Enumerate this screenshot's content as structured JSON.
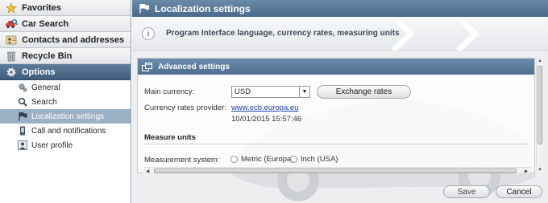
{
  "sidebar": {
    "categories": [
      {
        "label": "Favorites",
        "icon": "star-icon"
      },
      {
        "label": "Car Search",
        "icon": "car-search-icon"
      },
      {
        "label": "Contacts and addresses",
        "icon": "contacts-icon"
      },
      {
        "label": "Recycle Bin",
        "icon": "recycle-bin-icon"
      },
      {
        "label": "Options",
        "icon": "options-gear-icon"
      }
    ],
    "sub_items": [
      {
        "label": "General",
        "icon": "gears-icon"
      },
      {
        "label": "Search",
        "icon": "magnifier-icon"
      },
      {
        "label": "Localization settings",
        "icon": "flag-icon"
      },
      {
        "label": "Call and notifications",
        "icon": "phone-icon"
      },
      {
        "label": "User profile",
        "icon": "user-profile-icon"
      }
    ],
    "active_sub": "Localization settings"
  },
  "header": {
    "title": "Localization settings",
    "info": "Program Interface language, currency rates, measuring units"
  },
  "panel": {
    "title": "Advanced settings",
    "main_currency_label": "Main currency:",
    "main_currency_value": "USD",
    "exchange_button": "Exchange rates",
    "provider_label": "Currency rates provider:",
    "provider_link": "www.ecb.europa.eu",
    "provider_timestamp": "10/01/2015 15:57:46",
    "measure_heading": "Measure units",
    "measurement_label": "Measurement system:",
    "measurement_options": [
      "Metric (Europa)",
      "Inch (USA)"
    ]
  },
  "footer": {
    "save": "Save",
    "cancel": "Cancel"
  },
  "colors": {
    "accent": "#4a6a8b",
    "link": "#1a3fb0"
  }
}
